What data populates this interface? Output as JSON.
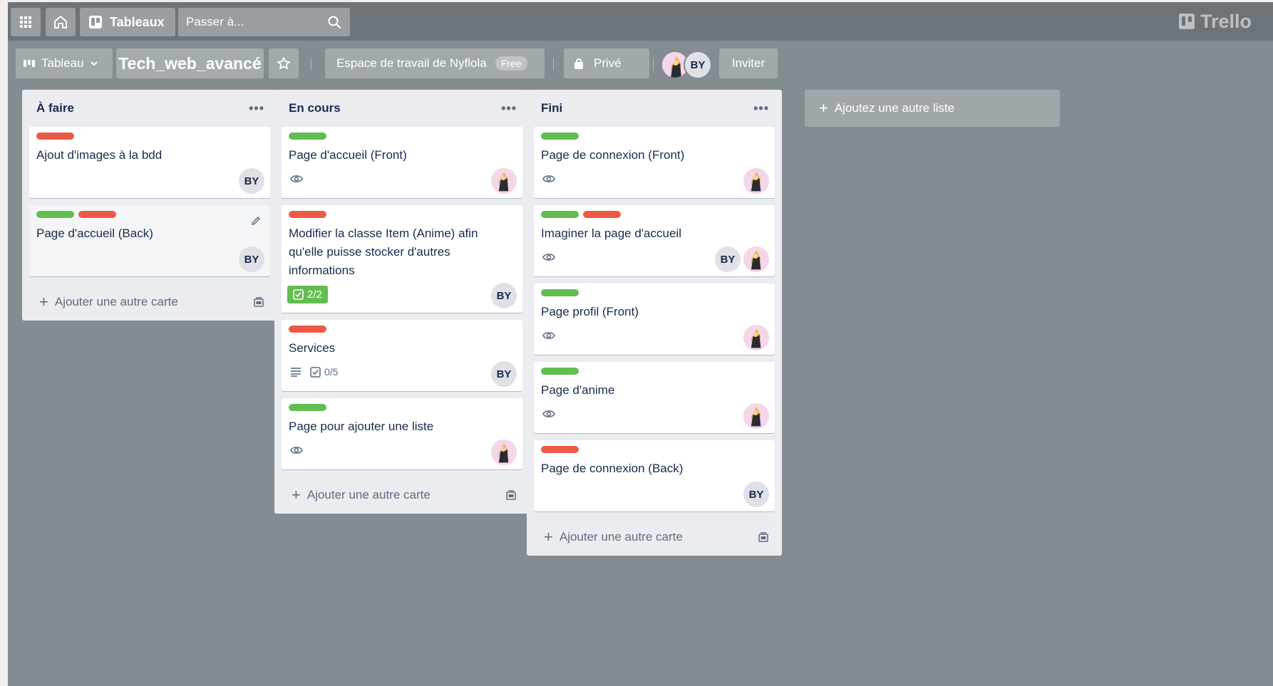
{
  "topbar": {
    "boards_label": "Tableaux",
    "search_placeholder": "Passer à...",
    "logo_text": "Trello"
  },
  "board": {
    "view_label": "Tableau",
    "title": "Tech_web_avancé",
    "workspace_label": "Espace de travail de Nyflola",
    "workspace_badge": "Free",
    "visibility_label": "Privé",
    "invite_label": "Inviter",
    "members": [
      {
        "type": "picture",
        "icon": "anime-avatar"
      },
      {
        "type": "initials",
        "initials": "BY"
      }
    ]
  },
  "lists": [
    {
      "title": "À faire",
      "add_card_label": "Ajouter une autre carte",
      "cards": [
        {
          "labels": [
            "red"
          ],
          "title": "Ajout d'images à la bdd",
          "badges": [],
          "members": [
            "BY"
          ]
        },
        {
          "labels": [
            "green",
            "red"
          ],
          "title": "Page d'accueil (Back)",
          "badges": [],
          "members": [
            "BY"
          ],
          "hover": true
        }
      ]
    },
    {
      "title": "En cours",
      "add_card_label": "Ajouter une autre carte",
      "cards": [
        {
          "labels": [
            "green"
          ],
          "title": "Page d'accueil (Front)",
          "badges": [
            "watch"
          ],
          "members": [
            "pic"
          ]
        },
        {
          "labels": [
            "red"
          ],
          "title": "Modifier la classe Item (Anime) afin qu'elle puisse stocker d'autres informations",
          "badges": [
            "checklist-done:2/2"
          ],
          "members": [
            "BY"
          ]
        },
        {
          "labels": [
            "red"
          ],
          "title": "Services",
          "badges": [
            "description",
            "checklist:0/5"
          ],
          "members": [
            "BY"
          ]
        },
        {
          "labels": [
            "green"
          ],
          "title": "Page pour ajouter une liste",
          "badges": [
            "watch"
          ],
          "members": [
            "pic"
          ]
        }
      ]
    },
    {
      "title": "Fini",
      "add_card_label": "Ajouter une autre carte",
      "cards": [
        {
          "labels": [
            "green"
          ],
          "title": "Page de connexion (Front)",
          "badges": [
            "watch"
          ],
          "members": [
            "pic"
          ]
        },
        {
          "labels": [
            "green",
            "red"
          ],
          "title": "Imaginer la page d'accueil",
          "badges": [
            "watch"
          ],
          "members": [
            "BY",
            "pic"
          ]
        },
        {
          "labels": [
            "green"
          ],
          "title": "Page profil (Front)",
          "badges": [
            "watch"
          ],
          "members": [
            "pic"
          ]
        },
        {
          "labels": [
            "green"
          ],
          "title": "Page d'anime",
          "badges": [
            "watch"
          ],
          "members": [
            "pic"
          ]
        },
        {
          "labels": [
            "red"
          ],
          "title": "Page de connexion (Back)",
          "badges": [],
          "members": [
            "BY"
          ]
        }
      ]
    }
  ],
  "add_list_label": "Ajoutez une autre liste",
  "colors": {
    "green_label": "#61bd4f",
    "red_label": "#eb5a46",
    "board_bg": "#838c91",
    "topbar_bg": "#6c7479"
  }
}
